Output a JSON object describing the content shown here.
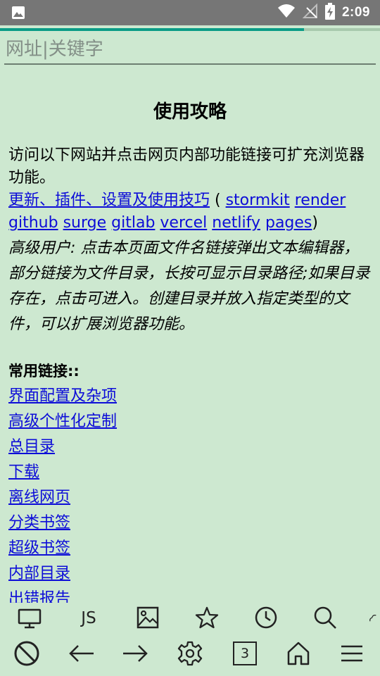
{
  "status_bar": {
    "time": "2:09",
    "icons": [
      "image-notification-icon",
      "wifi-icon",
      "signal-off-icon",
      "battery-charging-icon"
    ]
  },
  "page_load_progress_percent": 80,
  "address_bar": {
    "placeholder": "网址|关键字",
    "value": ""
  },
  "page": {
    "title": "使用攻略",
    "intro": "访问以下网站并点击网页内部功能链接可扩充浏览器功能。",
    "main_link": "更新、插件、设置及使用技巧",
    "open_paren": " ( ",
    "mirror_links": [
      "stormkit",
      "render",
      "github",
      "surge",
      "gitlab",
      "vercel",
      "netlify",
      "pages"
    ],
    "close_paren": ")",
    "advanced_note": "高级用户: 点击本页面文件名链接弹出文本编辑器，部分链接为文件目录，长按可显示目录路径;如果目录存在，点击可进入。创建目录并放入指定类型的文件，可以扩展浏览器功能。",
    "common_links_heading": "常用链接::",
    "common_links": [
      "界面配置及杂项",
      "高级个性化定制",
      "总目录",
      "下载",
      "离线网页",
      "分类书签",
      "超级书签",
      "内部目录",
      "出错报告"
    ]
  },
  "toolbar_top": {
    "items": [
      "desktop-mode-icon",
      "js-toggle",
      "image-toggle-icon",
      "bookmark-star-icon",
      "history-clock-icon",
      "search-icon",
      "cloud-icon"
    ],
    "js_label": "JS"
  },
  "toolbar_bottom": {
    "items": [
      "block-icon",
      "back-arrow-icon",
      "forward-arrow-icon",
      "settings-gear-icon",
      "tabs-count",
      "home-icon",
      "menu-icon"
    ],
    "tabs_count": "3"
  },
  "colors": {
    "background": "#cde8d0",
    "status_bar": "#767676",
    "progress": "#0a9c86",
    "link": "#0d0dd8"
  }
}
